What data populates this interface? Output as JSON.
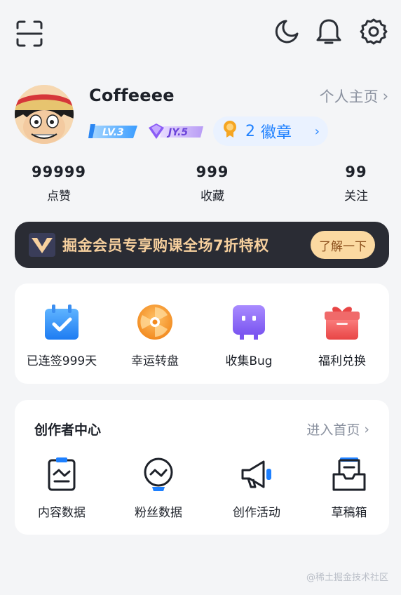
{
  "header": {
    "icons": [
      "scan-icon",
      "moon-icon",
      "bell-icon",
      "gear-icon"
    ]
  },
  "profile": {
    "username": "Coffeeee",
    "home_link": "个人主页",
    "level_badge": "LV.3",
    "jy_badge": "JY.5",
    "badge_count": "2",
    "badge_label": "徽章"
  },
  "stats": {
    "likes": {
      "value": "99999",
      "label": "点赞"
    },
    "favorites": {
      "value": "999",
      "label": "收藏"
    },
    "following": {
      "value": "99",
      "label": "关注"
    }
  },
  "vip": {
    "text": "掘金会员专享购课全场7折特权",
    "button": "了解一下"
  },
  "features": [
    {
      "label": "已连签999天",
      "icon": "calendar-check-icon"
    },
    {
      "label": "幸运转盘",
      "icon": "lucky-wheel-icon"
    },
    {
      "label": "收集Bug",
      "icon": "bug-box-icon"
    },
    {
      "label": "福利兑换",
      "icon": "gift-icon"
    }
  ],
  "creator": {
    "title": "创作者中心",
    "link": "进入首页",
    "items": [
      {
        "label": "内容数据",
        "icon": "content-data-icon"
      },
      {
        "label": "粉丝数据",
        "icon": "fans-data-icon"
      },
      {
        "label": "创作活动",
        "icon": "megaphone-icon"
      },
      {
        "label": "草稿箱",
        "icon": "draft-box-icon"
      }
    ]
  },
  "watermark": "@稀土掘金技术社区",
  "colors": {
    "accent": "#1e80ff",
    "vip_bg": "#2a2c34",
    "vip_text": "#f7d09e",
    "vip_button": "#fbd9a1"
  }
}
